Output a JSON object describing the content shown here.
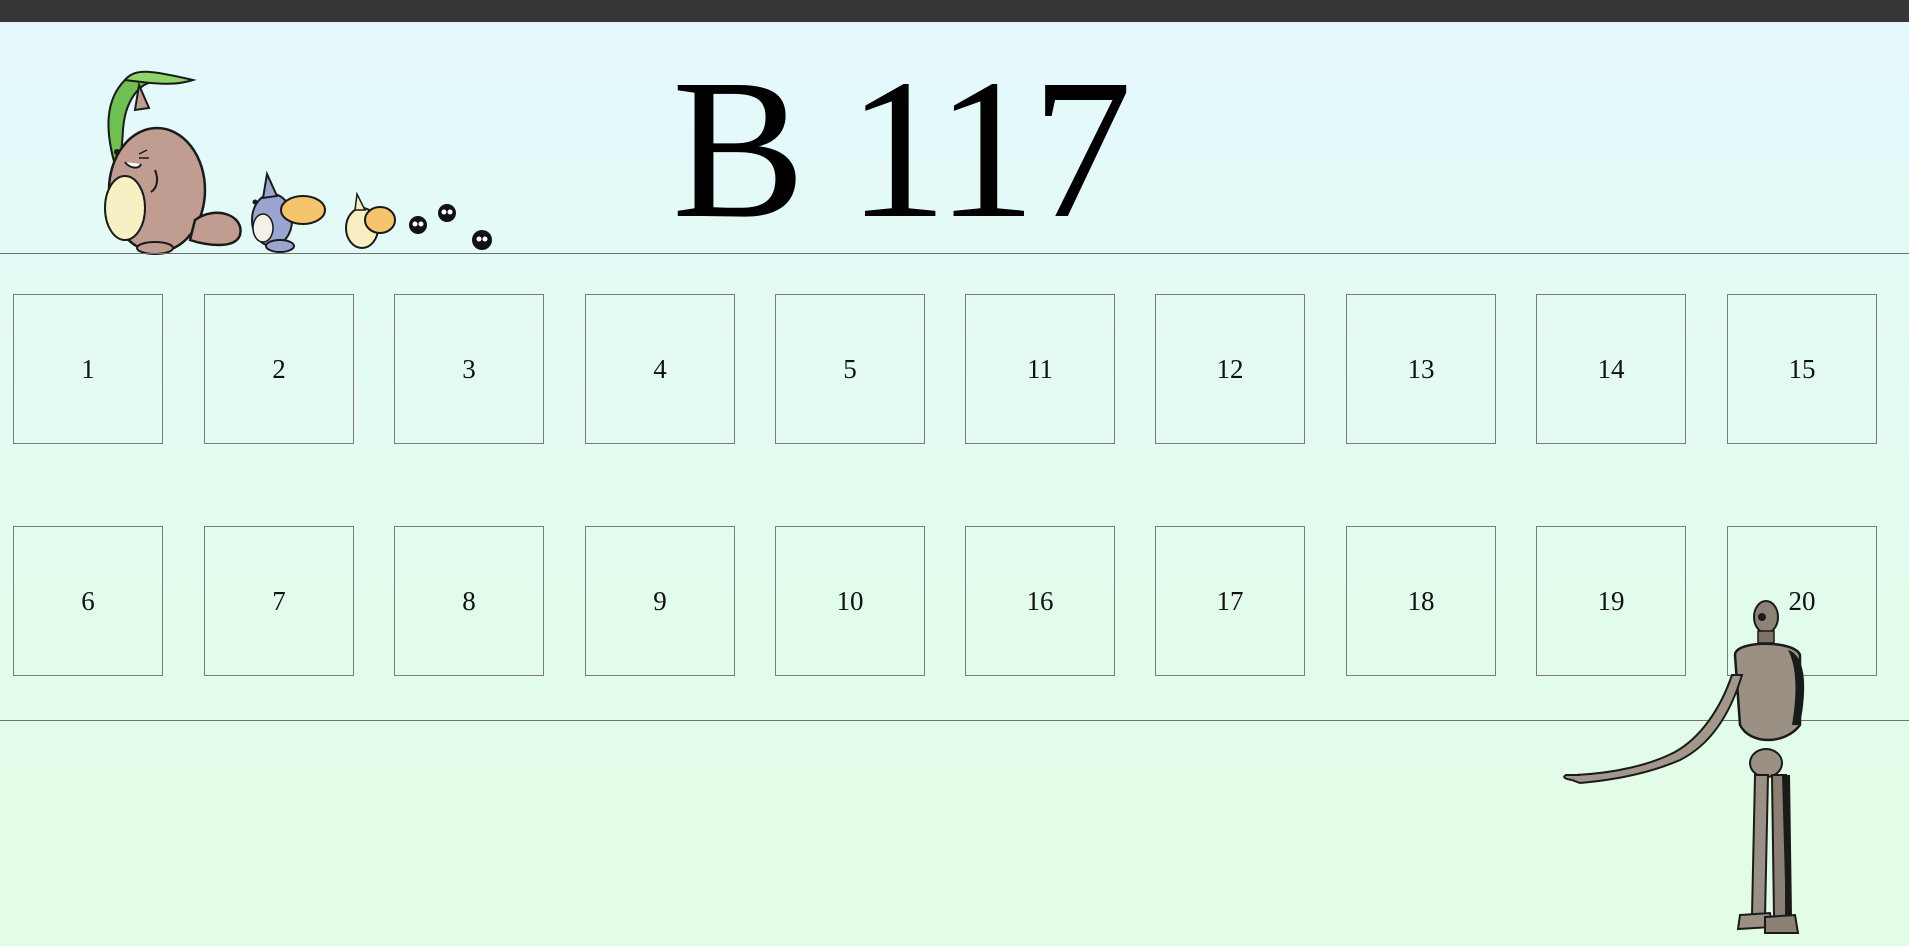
{
  "room": {
    "title": "B 117"
  },
  "seats": {
    "row1": [
      "1",
      "2",
      "3",
      "4",
      "5",
      "11",
      "12",
      "13",
      "14",
      "15"
    ],
    "row2": [
      "6",
      "7",
      "8",
      "9",
      "10",
      "16",
      "17",
      "18",
      "19",
      "20"
    ]
  },
  "illustrations": {
    "left": "totoro-family-icon",
    "right": "laputa-robot-icon"
  },
  "colors": {
    "top_bar": "#363636",
    "background_top": "#e5f8fe",
    "background_bottom": "#e1fde5",
    "seat_border": "#7b7b7b"
  }
}
